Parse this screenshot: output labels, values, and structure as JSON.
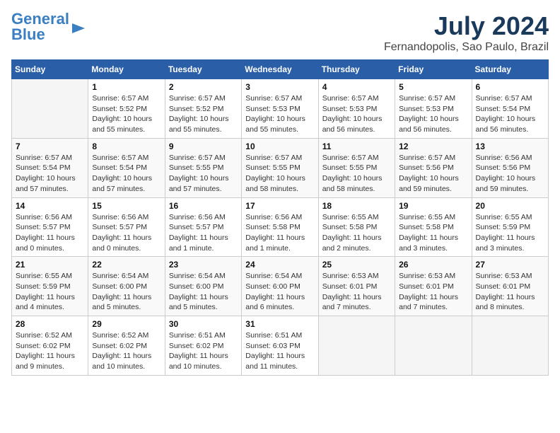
{
  "header": {
    "logo_line1": "General",
    "logo_line2": "Blue",
    "month_year": "July 2024",
    "location": "Fernandopolis, Sao Paulo, Brazil"
  },
  "weekdays": [
    "Sunday",
    "Monday",
    "Tuesday",
    "Wednesday",
    "Thursday",
    "Friday",
    "Saturday"
  ],
  "weeks": [
    [
      {
        "day": "",
        "info": ""
      },
      {
        "day": "1",
        "info": "Sunrise: 6:57 AM\nSunset: 5:52 PM\nDaylight: 10 hours\nand 55 minutes."
      },
      {
        "day": "2",
        "info": "Sunrise: 6:57 AM\nSunset: 5:52 PM\nDaylight: 10 hours\nand 55 minutes."
      },
      {
        "day": "3",
        "info": "Sunrise: 6:57 AM\nSunset: 5:53 PM\nDaylight: 10 hours\nand 55 minutes."
      },
      {
        "day": "4",
        "info": "Sunrise: 6:57 AM\nSunset: 5:53 PM\nDaylight: 10 hours\nand 56 minutes."
      },
      {
        "day": "5",
        "info": "Sunrise: 6:57 AM\nSunset: 5:53 PM\nDaylight: 10 hours\nand 56 minutes."
      },
      {
        "day": "6",
        "info": "Sunrise: 6:57 AM\nSunset: 5:54 PM\nDaylight: 10 hours\nand 56 minutes."
      }
    ],
    [
      {
        "day": "7",
        "info": "Sunrise: 6:57 AM\nSunset: 5:54 PM\nDaylight: 10 hours\nand 57 minutes."
      },
      {
        "day": "8",
        "info": "Sunrise: 6:57 AM\nSunset: 5:54 PM\nDaylight: 10 hours\nand 57 minutes."
      },
      {
        "day": "9",
        "info": "Sunrise: 6:57 AM\nSunset: 5:55 PM\nDaylight: 10 hours\nand 57 minutes."
      },
      {
        "day": "10",
        "info": "Sunrise: 6:57 AM\nSunset: 5:55 PM\nDaylight: 10 hours\nand 58 minutes."
      },
      {
        "day": "11",
        "info": "Sunrise: 6:57 AM\nSunset: 5:55 PM\nDaylight: 10 hours\nand 58 minutes."
      },
      {
        "day": "12",
        "info": "Sunrise: 6:57 AM\nSunset: 5:56 PM\nDaylight: 10 hours\nand 59 minutes."
      },
      {
        "day": "13",
        "info": "Sunrise: 6:56 AM\nSunset: 5:56 PM\nDaylight: 10 hours\nand 59 minutes."
      }
    ],
    [
      {
        "day": "14",
        "info": "Sunrise: 6:56 AM\nSunset: 5:57 PM\nDaylight: 11 hours\nand 0 minutes."
      },
      {
        "day": "15",
        "info": "Sunrise: 6:56 AM\nSunset: 5:57 PM\nDaylight: 11 hours\nand 0 minutes."
      },
      {
        "day": "16",
        "info": "Sunrise: 6:56 AM\nSunset: 5:57 PM\nDaylight: 11 hours\nand 1 minute."
      },
      {
        "day": "17",
        "info": "Sunrise: 6:56 AM\nSunset: 5:58 PM\nDaylight: 11 hours\nand 1 minute."
      },
      {
        "day": "18",
        "info": "Sunrise: 6:55 AM\nSunset: 5:58 PM\nDaylight: 11 hours\nand 2 minutes."
      },
      {
        "day": "19",
        "info": "Sunrise: 6:55 AM\nSunset: 5:58 PM\nDaylight: 11 hours\nand 3 minutes."
      },
      {
        "day": "20",
        "info": "Sunrise: 6:55 AM\nSunset: 5:59 PM\nDaylight: 11 hours\nand 3 minutes."
      }
    ],
    [
      {
        "day": "21",
        "info": "Sunrise: 6:55 AM\nSunset: 5:59 PM\nDaylight: 11 hours\nand 4 minutes."
      },
      {
        "day": "22",
        "info": "Sunrise: 6:54 AM\nSunset: 6:00 PM\nDaylight: 11 hours\nand 5 minutes."
      },
      {
        "day": "23",
        "info": "Sunrise: 6:54 AM\nSunset: 6:00 PM\nDaylight: 11 hours\nand 5 minutes."
      },
      {
        "day": "24",
        "info": "Sunrise: 6:54 AM\nSunset: 6:00 PM\nDaylight: 11 hours\nand 6 minutes."
      },
      {
        "day": "25",
        "info": "Sunrise: 6:53 AM\nSunset: 6:01 PM\nDaylight: 11 hours\nand 7 minutes."
      },
      {
        "day": "26",
        "info": "Sunrise: 6:53 AM\nSunset: 6:01 PM\nDaylight: 11 hours\nand 7 minutes."
      },
      {
        "day": "27",
        "info": "Sunrise: 6:53 AM\nSunset: 6:01 PM\nDaylight: 11 hours\nand 8 minutes."
      }
    ],
    [
      {
        "day": "28",
        "info": "Sunrise: 6:52 AM\nSunset: 6:02 PM\nDaylight: 11 hours\nand 9 minutes."
      },
      {
        "day": "29",
        "info": "Sunrise: 6:52 AM\nSunset: 6:02 PM\nDaylight: 11 hours\nand 10 minutes."
      },
      {
        "day": "30",
        "info": "Sunrise: 6:51 AM\nSunset: 6:02 PM\nDaylight: 11 hours\nand 10 minutes."
      },
      {
        "day": "31",
        "info": "Sunrise: 6:51 AM\nSunset: 6:03 PM\nDaylight: 11 hours\nand 11 minutes."
      },
      {
        "day": "",
        "info": ""
      },
      {
        "day": "",
        "info": ""
      },
      {
        "day": "",
        "info": ""
      }
    ]
  ]
}
